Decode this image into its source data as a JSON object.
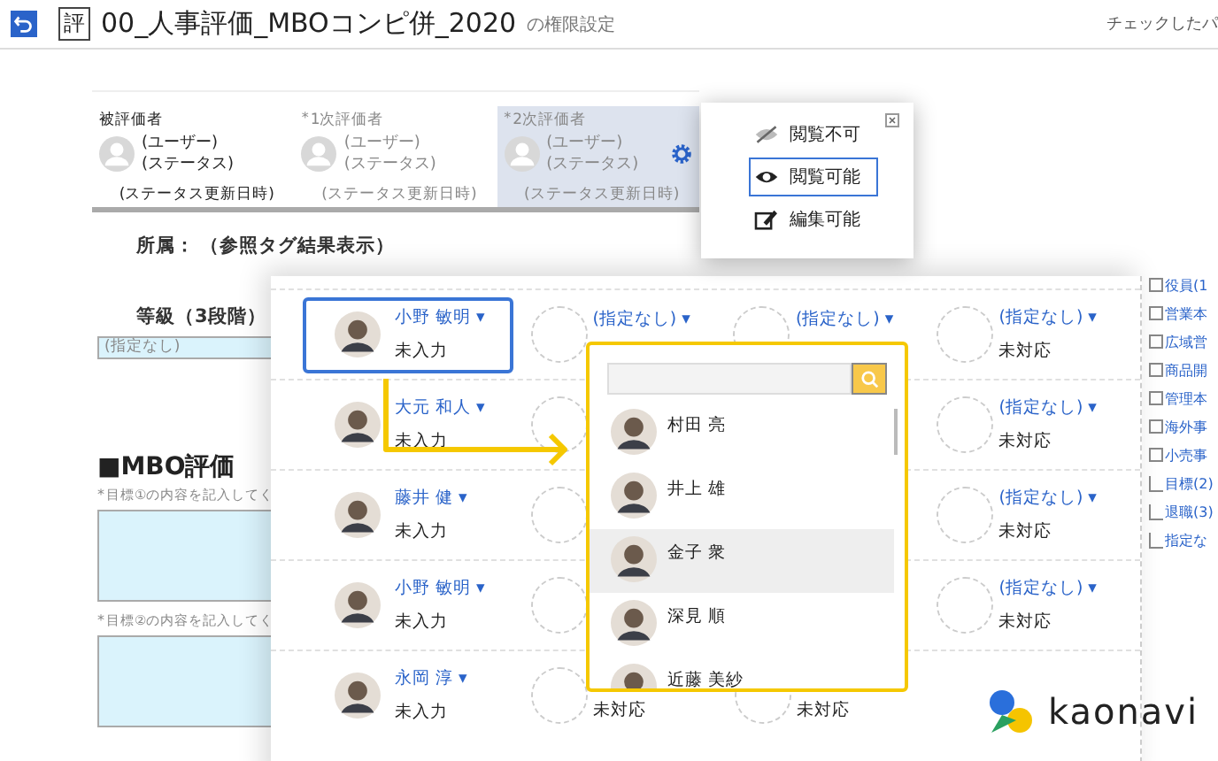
{
  "header": {
    "badge": "評",
    "title": "00_人事評価_MBOコンピ併_2020",
    "subtitle": "の権限設定",
    "right_text": "チェックしたパ"
  },
  "evaluators": [
    {
      "label": "被評価者",
      "disabled": false,
      "selected": false,
      "name": "(ユーザー)",
      "status": "(ステータス)",
      "updated": "(ステータス更新日時)"
    },
    {
      "required_mark": "*",
      "label": "1次評価者",
      "disabled": true,
      "selected": false,
      "name": "(ユーザー)",
      "status": "(ステータス)",
      "updated": "(ステータス更新日時)"
    },
    {
      "required_mark": "*",
      "label": "2次評価者",
      "disabled": true,
      "selected": true,
      "name": "(ユーザー)",
      "status": "(ステータス)",
      "updated": "(ステータス更新日時)"
    }
  ],
  "permission_menu": {
    "items": [
      {
        "kind": "hidden",
        "label": "閲覧不可",
        "selected": false
      },
      {
        "kind": "view",
        "label": "閲覧可能",
        "selected": true
      },
      {
        "kind": "edit",
        "label": "編集可能",
        "selected": false
      }
    ]
  },
  "form": {
    "affiliation_label": "所属：",
    "affiliation_value": "（参照タグ結果表示）",
    "grade_label": "等級（3段階）",
    "grade_value": "(指定なし)",
    "section_title": "■MBO評価",
    "goals": [
      {
        "required_mark": "*",
        "label": "目標①の内容を記入してく"
      },
      {
        "required_mark": "*",
        "label": "目標②の内容を記入してく"
      }
    ]
  },
  "table": {
    "rows": [
      {
        "cells": [
          {
            "kind": "person",
            "name": "小野 敏明 ▾",
            "status": "未入力",
            "selected": true
          },
          {
            "kind": "empty",
            "name": "(指定なし) ▾"
          },
          {
            "kind": "empty",
            "name": "(指定なし) ▾"
          },
          {
            "kind": "empty",
            "name": "(指定なし) ▾",
            "status": "未対応"
          }
        ]
      },
      {
        "cells": [
          {
            "kind": "person",
            "name": "大元 和人 ▾",
            "status": "未入力",
            "selected": false
          },
          {
            "kind": "empty"
          },
          {
            "kind": "covered"
          },
          {
            "kind": "empty",
            "name": "(指定なし) ▾",
            "status": "未対応"
          }
        ]
      },
      {
        "cells": [
          {
            "kind": "person",
            "name": "藤井 健 ▾",
            "status": "未入力",
            "selected": false
          },
          {
            "kind": "empty"
          },
          {
            "kind": "covered"
          },
          {
            "kind": "empty",
            "name": "(指定なし) ▾",
            "status": "未対応"
          }
        ]
      },
      {
        "cells": [
          {
            "kind": "person",
            "name": "小野 敏明 ▾",
            "status": "未入力",
            "selected": false
          },
          {
            "kind": "empty"
          },
          {
            "kind": "covered"
          },
          {
            "kind": "empty",
            "name": "(指定なし) ▾",
            "status": "未対応"
          }
        ]
      },
      {
        "cells": [
          {
            "kind": "person",
            "name": "永岡 淳 ▾",
            "status": "未入力",
            "selected": false
          },
          {
            "kind": "empty",
            "status": "未対応"
          },
          {
            "kind": "empty",
            "status": "未対応"
          }
        ]
      }
    ]
  },
  "tree": [
    {
      "label": "役員(1",
      "expandable": true
    },
    {
      "label": "営業本",
      "expandable": true
    },
    {
      "label": "広域営",
      "expandable": true
    },
    {
      "label": "商品開",
      "expandable": true
    },
    {
      "label": "管理本",
      "expandable": true
    },
    {
      "label": "海外事",
      "expandable": true
    },
    {
      "label": "小売事",
      "expandable": true
    },
    {
      "label": "目標(2)",
      "expandable": false
    },
    {
      "label": "退職(3)",
      "expandable": false
    },
    {
      "label": "指定な",
      "expandable": false
    }
  ],
  "picker": {
    "people": [
      {
        "name": "村田 亮",
        "selected": false
      },
      {
        "name": "井上 雄",
        "selected": false
      },
      {
        "name": "金子 衆",
        "selected": true
      },
      {
        "name": "深見 順",
        "selected": false
      },
      {
        "name": "近藤 美紗",
        "selected": false
      }
    ]
  },
  "logo": {
    "text": "kaonavi"
  }
}
